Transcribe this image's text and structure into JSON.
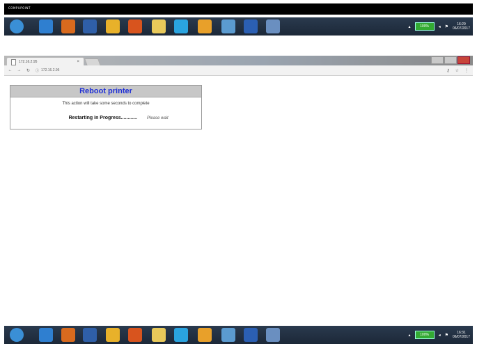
{
  "top_strip": {
    "label": "COMPUPOINT"
  },
  "taskbar": {
    "icons": [
      {
        "name": "start-icon",
        "color": "#3a8fd6"
      },
      {
        "name": "internet-explorer-icon",
        "color": "#2f7fd0"
      },
      {
        "name": "media-player-icon",
        "color": "#d86a1e"
      },
      {
        "name": "app-icon",
        "color": "#2f5fa8"
      },
      {
        "name": "chrome-icon",
        "color": "#e8b12a"
      },
      {
        "name": "firefox-icon",
        "color": "#d8541e"
      },
      {
        "name": "folder-icon",
        "color": "#e8c95a"
      },
      {
        "name": "skype-icon",
        "color": "#2aa4e0"
      },
      {
        "name": "outlook-icon",
        "color": "#e8a02a"
      },
      {
        "name": "computer-icon",
        "color": "#5b9bd0"
      },
      {
        "name": "word-icon",
        "color": "#2b5fb3"
      },
      {
        "name": "paint-icon",
        "color": "#6a8fc0"
      }
    ],
    "battery": "100%",
    "time": "16:29",
    "date": "06/07/2017",
    "time_bottom": "16:31",
    "date_bottom": "06/07/2017"
  },
  "browser": {
    "tab_title": "172.16.2.95",
    "url": "172.16.2.95"
  },
  "panel": {
    "title": "Reboot printer",
    "message": "This action will take some seconds to complete",
    "status_label": "Restarting in Progress............",
    "status_hint": "Please wait"
  }
}
